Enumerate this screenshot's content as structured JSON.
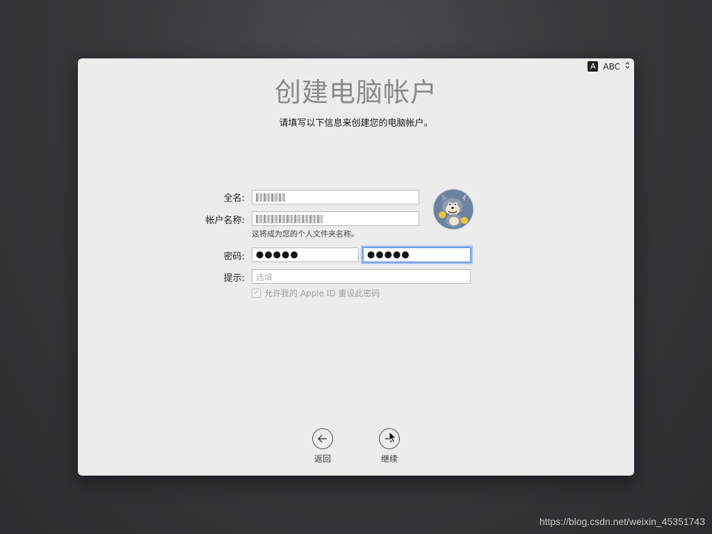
{
  "input_source": {
    "badge": "A",
    "label": "ABC",
    "chevron": "⌃⌄"
  },
  "page_title": "创建电脑帐户",
  "subtitle": "请填写以下信息来创建您的电脑帐户。",
  "form": {
    "full_name_label": "全名:",
    "account_name_label": "帐户名称:",
    "account_name_help": "这将成为您的个人文件夹名称。",
    "password_label": "密码:",
    "password_value": "●●●●●",
    "verify_value": "●●●●●",
    "hint_label": "提示:",
    "hint_placeholder": "选填",
    "apple_id_checkbox": "允许我的 Apple ID 重设此密码",
    "apple_id_checked": true
  },
  "nav": {
    "back_label": "返回",
    "continue_label": "继续"
  },
  "watermark": "https://blog.csdn.net/weixin_45351743"
}
